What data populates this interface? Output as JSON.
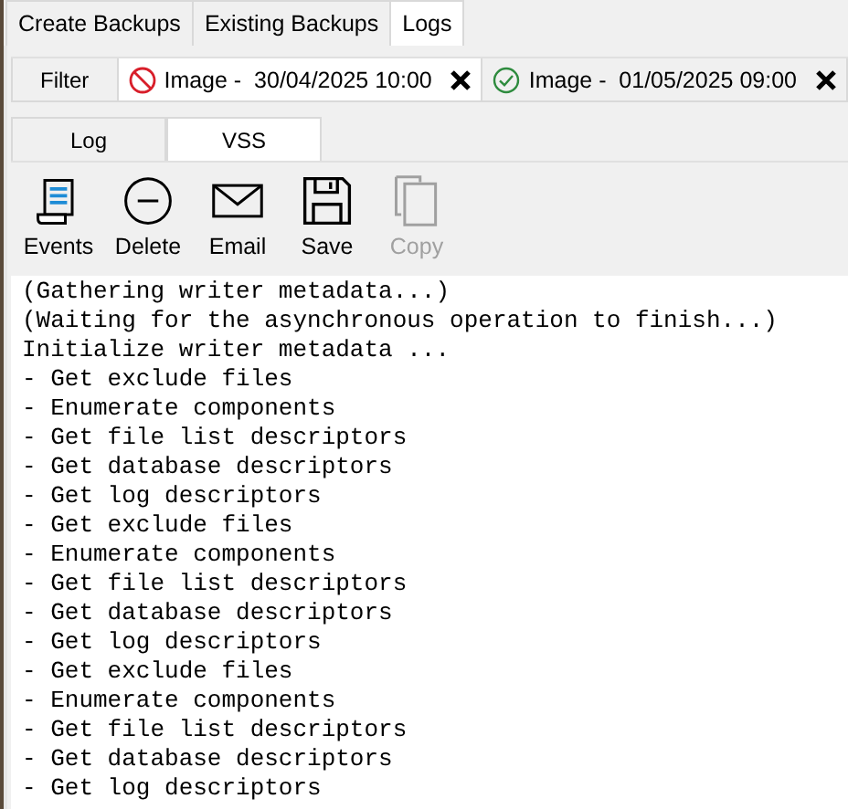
{
  "tabs": [
    {
      "label": "Create Backups",
      "selected": false
    },
    {
      "label": "Existing Backups",
      "selected": false
    },
    {
      "label": "Logs",
      "selected": true
    }
  ],
  "filter": {
    "label": "Filter",
    "chips": [
      {
        "kind": "failed",
        "label": "Image -  30/04/2025 10:00",
        "selected": true
      },
      {
        "kind": "succeeded",
        "label": "Image -  01/05/2025 09:00",
        "selected": false
      }
    ]
  },
  "sub_tabs": [
    {
      "label": "Log",
      "selected": false
    },
    {
      "label": "VSS",
      "selected": true
    }
  ],
  "toolbar": [
    {
      "kind": "events",
      "label": "Events",
      "disabled": false
    },
    {
      "kind": "delete",
      "label": "Delete",
      "disabled": false
    },
    {
      "kind": "email",
      "label": "Email",
      "disabled": false
    },
    {
      "kind": "save",
      "label": "Save",
      "disabled": false
    },
    {
      "kind": "copy",
      "label": "Copy",
      "disabled": true
    }
  ],
  "log_lines": [
    "(Gathering writer metadata...)",
    "(Waiting for the asynchronous operation to finish...)",
    "Initialize writer metadata ...",
    "- Get exclude files",
    "- Enumerate components",
    "- Get file list descriptors",
    "- Get database descriptors",
    "- Get log descriptors",
    "- Get exclude files",
    "- Enumerate components",
    "- Get file list descriptors",
    "- Get database descriptors",
    "- Get log descriptors",
    "- Get exclude files",
    "- Enumerate components",
    "- Get file list descriptors",
    "- Get database descriptors",
    "- Get log descriptors"
  ]
}
